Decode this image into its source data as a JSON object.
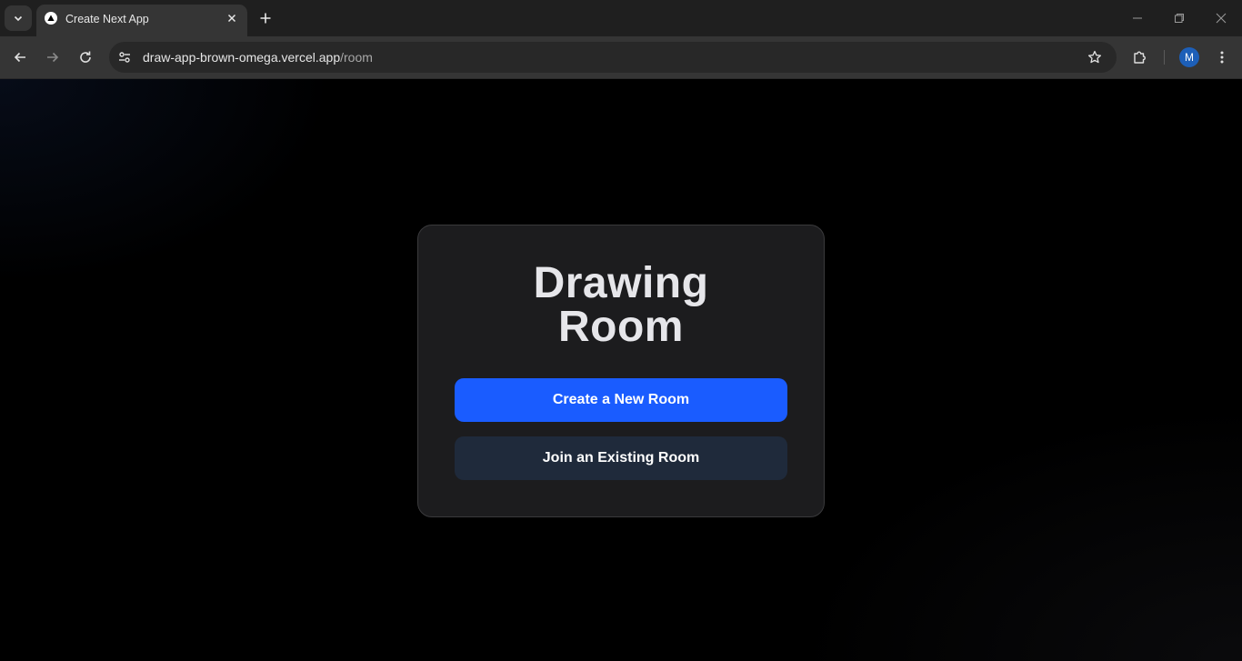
{
  "browser": {
    "tab": {
      "title": "Create Next App"
    },
    "address_bar": {
      "host": "draw-app-brown-omega.vercel.app",
      "path": "/room"
    },
    "profile_initial": "M"
  },
  "main": {
    "card": {
      "title_line1": "Drawing",
      "title_line2": "Room",
      "create_button_label": "Create a New Room",
      "join_button_label": "Join an Existing Room"
    }
  },
  "colors": {
    "primary_button": "#1a5cff",
    "secondary_button": "#1f2a3b",
    "card_background": "#1c1c1e",
    "page_background": "#000000"
  }
}
